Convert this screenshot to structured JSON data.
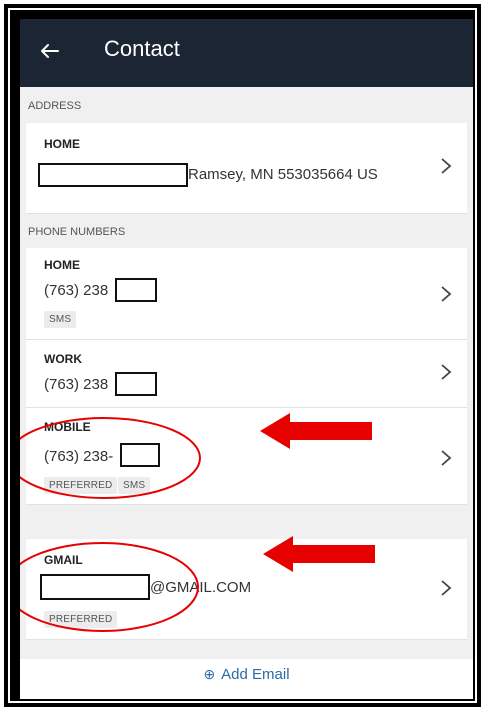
{
  "header": {
    "title": "Contact"
  },
  "address_section": {
    "header": "ADDRESS",
    "items": [
      {
        "label": "HOME",
        "value_suffix": "Ramsey, MN 553035664 US"
      }
    ]
  },
  "phone_section": {
    "header": "PHONE NUMBERS",
    "items": [
      {
        "label": "HOME",
        "value": "(763) 238",
        "badges": [
          "SMS"
        ]
      },
      {
        "label": "WORK",
        "value": "(763) 238"
      },
      {
        "label": "MOBILE",
        "value": "(763) 238-",
        "badges": [
          "PREFERRED",
          "SMS"
        ]
      }
    ]
  },
  "email_section": {
    "items": [
      {
        "label": "GMAIL",
        "value_suffix": "@GMAIL.COM",
        "badges": [
          "PREFERRED"
        ]
      }
    ]
  },
  "actions": {
    "add_email": "Add Email"
  },
  "colors": {
    "appbar": "#1c2533",
    "accent": "#2a6aa8",
    "annotation": "#e60000"
  }
}
